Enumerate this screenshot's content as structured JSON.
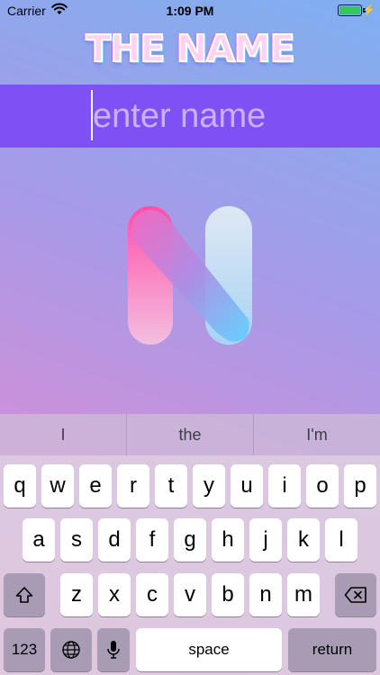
{
  "status_bar": {
    "carrier": "Carrier",
    "time": "1:09 PM"
  },
  "logo": {
    "text": "THE NAME"
  },
  "name_field": {
    "placeholder": "enter name",
    "value": ""
  },
  "suggestions": [
    "I",
    "the",
    "I'm"
  ],
  "keyboard": {
    "row1": [
      "q",
      "w",
      "e",
      "r",
      "t",
      "y",
      "u",
      "i",
      "o",
      "p"
    ],
    "row2": [
      "a",
      "s",
      "d",
      "f",
      "g",
      "h",
      "j",
      "k",
      "l"
    ],
    "row3": [
      "z",
      "x",
      "c",
      "v",
      "b",
      "n",
      "m"
    ],
    "numbers_label": "123",
    "space_label": "space",
    "return_label": "return"
  },
  "colors": {
    "name_bar": "#7f50f3",
    "battery": "#34c759",
    "n_left_top": "#ff4fa8",
    "n_right_bottom": "#5fd0ff"
  },
  "icons": [
    "wifi-icon",
    "battery-icon",
    "charging-bolt-icon",
    "shift-icon",
    "globe-icon",
    "microphone-icon",
    "delete-icon"
  ]
}
